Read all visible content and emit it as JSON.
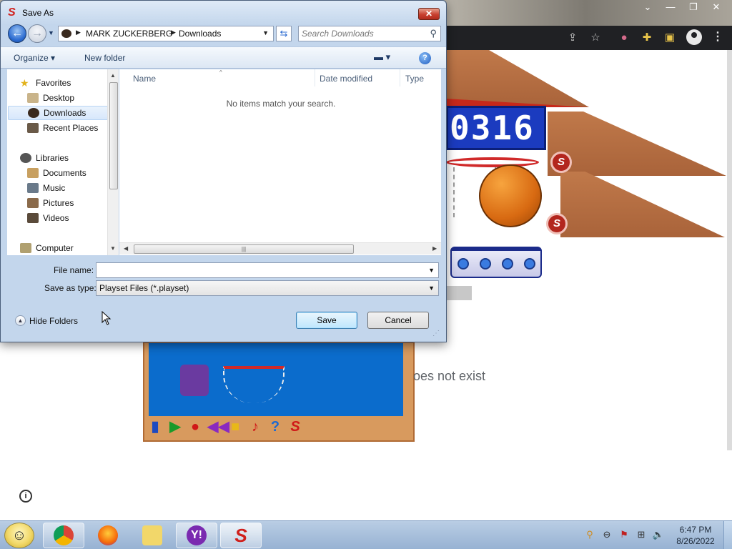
{
  "chrome": {
    "toolbar_icons": [
      "share-icon",
      "star-icon",
      "extension-icon",
      "puzzle-icon",
      "sidepanel-icon",
      "profile-icon",
      "menu-icon"
    ]
  },
  "game": {
    "score": "0316",
    "logo_letter": "S",
    "error_text": "oes not exist"
  },
  "dialog": {
    "title": "Save As",
    "close_label": "✕",
    "breadcrumb": [
      "MARK ZUCKERBERG",
      "Downloads"
    ],
    "search_placeholder": "Search Downloads",
    "organize_label": "Organize ▾",
    "new_folder_label": "New folder",
    "help_label": "?",
    "nav": {
      "favorites_header": "Favorites",
      "favorites": [
        "Desktop",
        "Downloads",
        "Recent Places"
      ],
      "selected": "Downloads",
      "libraries_header": "Libraries",
      "libraries": [
        "Documents",
        "Music",
        "Pictures",
        "Videos"
      ],
      "computer_header": "Computer"
    },
    "columns": [
      "Name",
      "Date modified",
      "Type"
    ],
    "empty_message": "No items match your search.",
    "file_name_label": "File name:",
    "file_name_value": "",
    "save_type_label": "Save as type:",
    "save_type_value": "Playset Files (*.playset)",
    "hide_folders_label": "Hide Folders",
    "save_label": "Save",
    "cancel_label": "Cancel"
  },
  "taskbar": {
    "time": "6:47 PM",
    "date": "8/26/2022"
  }
}
